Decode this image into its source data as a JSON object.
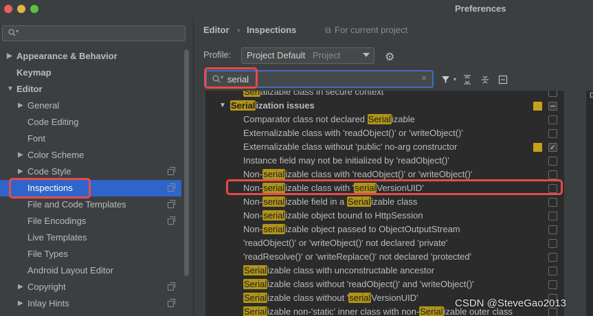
{
  "window": {
    "title": "Preferences"
  },
  "sidebar": {
    "search_placeholder": "",
    "items": [
      {
        "label": "Appearance & Behavior",
        "arrow": "▶",
        "bold": true
      },
      {
        "label": "Keymap",
        "arrow": "",
        "bold": true
      },
      {
        "label": "Editor",
        "arrow": "▼",
        "bold": true
      },
      {
        "label": "General",
        "arrow": "▶"
      },
      {
        "label": "Code Editing",
        "arrow": ""
      },
      {
        "label": "Font",
        "arrow": ""
      },
      {
        "label": "Color Scheme",
        "arrow": "▶"
      },
      {
        "label": "Code Style",
        "arrow": "▶"
      },
      {
        "label": "Inspections",
        "arrow": ""
      },
      {
        "label": "File and Code Templates",
        "arrow": ""
      },
      {
        "label": "File Encodings",
        "arrow": ""
      },
      {
        "label": "Live Templates",
        "arrow": ""
      },
      {
        "label": "File Types",
        "arrow": ""
      },
      {
        "label": "Android Layout Editor",
        "arrow": ""
      },
      {
        "label": "Copyright",
        "arrow": "▶"
      },
      {
        "label": "Inlay Hints",
        "arrow": "▶"
      }
    ]
  },
  "breadcrumb": {
    "root": "Editor",
    "sep": "›",
    "current": "Inspections",
    "scope": "For current project"
  },
  "profile": {
    "label": "Profile:",
    "value": "Project Default",
    "sub": "Project"
  },
  "filter": {
    "value": "serial"
  },
  "tree": {
    "rows": [
      {
        "parts": [
          "Seri",
          "alizable class in secure context"
        ],
        "hl": [
          0
        ]
      },
      {
        "parts": [
          "Serial",
          "ization issues"
        ],
        "hl": [
          0
        ],
        "group": true
      },
      {
        "parts": [
          "Comparator class not declared ",
          "Serial",
          "izable"
        ],
        "hl": [
          1
        ]
      },
      {
        "parts": [
          "Externalizable class with 'readObject()' or 'writeObject()'"
        ],
        "hl": []
      },
      {
        "parts": [
          "Externalizable class without 'public' no-arg constructor"
        ],
        "hl": []
      },
      {
        "parts": [
          "Instance field may not be initialized by 'readObject()'"
        ],
        "hl": []
      },
      {
        "parts": [
          "Non-",
          "serial",
          "izable class with 'readObject()' or 'writeObject()'"
        ],
        "hl": [
          1
        ]
      },
      {
        "parts": [
          "Non-",
          "serial",
          "izable class with '",
          "serial",
          "VersionUID'"
        ],
        "hl": [
          1,
          3
        ]
      },
      {
        "parts": [
          "Non-",
          "serial",
          "izable field in a ",
          "Serial",
          "izable class"
        ],
        "hl": [
          1,
          3
        ]
      },
      {
        "parts": [
          "Non-",
          "serial",
          "izable object bound to HttpSession"
        ],
        "hl": [
          1
        ]
      },
      {
        "parts": [
          "Non-",
          "serial",
          "izable object passed to ObjectOutputStream"
        ],
        "hl": [
          1
        ]
      },
      {
        "parts": [
          "'readObject()' or 'writeObject()' not declared 'private'"
        ],
        "hl": []
      },
      {
        "parts": [
          "'readResolve()' or 'writeReplace()' not declared 'protected'"
        ],
        "hl": []
      },
      {
        "parts": [
          "Serial",
          "izable class with unconstructable ancestor"
        ],
        "hl": [
          0
        ]
      },
      {
        "parts": [
          "Serial",
          "izable class without 'readObject()' and 'writeObject()'"
        ],
        "hl": [
          0
        ]
      },
      {
        "parts": [
          "Serial",
          "izable class without '",
          "serial",
          "VersionUID'"
        ],
        "hl": [
          0,
          2
        ]
      },
      {
        "parts": [
          "Serial",
          "izable non-'static' inner class with non-",
          "Serial",
          "izable outer class"
        ],
        "hl": [
          0,
          2
        ]
      }
    ]
  },
  "right_panel": {
    "label": "D"
  },
  "watermark": "CSDN @SteveGao2013",
  "colors": {
    "highlight": "#b09419",
    "selection": "#2f65ca",
    "annotation_box": "#e84a4a",
    "severity": "#c6a11a"
  }
}
